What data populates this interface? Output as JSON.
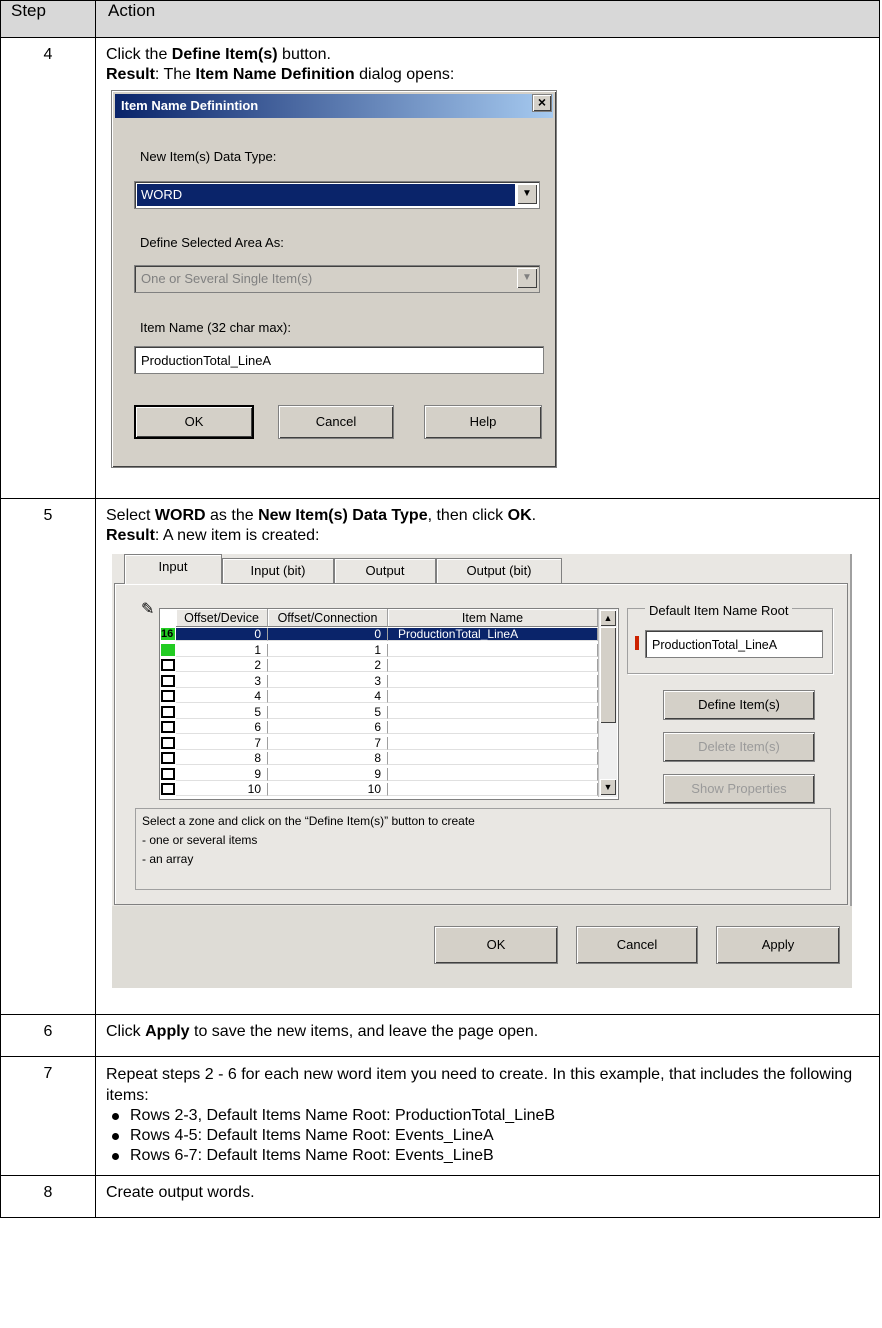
{
  "header": {
    "step": "Step",
    "action": "Action"
  },
  "steps": {
    "s4": {
      "num": "4",
      "line1": {
        "pre": "Click the ",
        "bold": "Define Item(s)",
        "post": " button."
      },
      "line2": {
        "b1": "Result",
        "t1": ": The ",
        "b2": "Item Name Definition",
        "t2": " dialog opens:"
      }
    },
    "s5": {
      "num": "5",
      "line1": {
        "t1": "Select ",
        "b1": "WORD",
        "t2": " as the ",
        "b2": "New Item(s) Data Type",
        "t3": ", then click ",
        "b3": "OK",
        "t4": "."
      },
      "line2": {
        "b1": "Result",
        "t1": ": A new item is created:"
      }
    },
    "s6": {
      "num": "6",
      "t1": "Click ",
      "b1": "Apply",
      "t2": " to save the new items, and leave the page open."
    },
    "s7": {
      "num": "7",
      "text": "Repeat steps 2 - 6 for each new word item you need to create. In this example, that includes the following items:",
      "items": [
        "Rows 2-3, Default Items Name Root: ProductionTotal_LineB",
        "Rows 4-5: Default Items Name Root: Events_LineA",
        "Rows 6-7: Default Items Name Root: Events_LineB"
      ]
    },
    "s8": {
      "num": "8",
      "text": "Create output words."
    }
  },
  "dialog": {
    "title": "Item Name Definintion",
    "close": "×",
    "data_type_label": "New Item(s) Data Type:",
    "data_type_value": "WORD",
    "area_label": "Define Selected Area As:",
    "area_value": "One or Several Single Item(s)",
    "name_label": "Item Name (32 char max):",
    "name_value": "ProductionTotal_LineA",
    "ok": "OK",
    "cancel": "Cancel",
    "help": "Help"
  },
  "panel": {
    "tabs": [
      "Input",
      "Input (bit)",
      "Output",
      "Output (bit)"
    ],
    "columns": [
      "Offset/Device",
      "Offset/Connection",
      "Item Name"
    ],
    "badge": "16",
    "rows": [
      {
        "dev": "0",
        "conn": "0",
        "name": "ProductionTotal_LineA"
      },
      {
        "dev": "1",
        "conn": "1",
        "name": ""
      },
      {
        "dev": "2",
        "conn": "2",
        "name": ""
      },
      {
        "dev": "3",
        "conn": "3",
        "name": ""
      },
      {
        "dev": "4",
        "conn": "4",
        "name": ""
      },
      {
        "dev": "5",
        "conn": "5",
        "name": ""
      },
      {
        "dev": "6",
        "conn": "6",
        "name": ""
      },
      {
        "dev": "7",
        "conn": "7",
        "name": ""
      },
      {
        "dev": "8",
        "conn": "8",
        "name": ""
      },
      {
        "dev": "9",
        "conn": "9",
        "name": ""
      },
      {
        "dev": "10",
        "conn": "10",
        "name": ""
      }
    ],
    "root_group_label": "Default Item Name Root",
    "root_value": "ProductionTotal_LineA",
    "define_button": "Define Item(s)",
    "delete_button": "Delete Item(s)",
    "properties_button": "Show Properties",
    "info_lines": [
      "Select a zone and click on the “Define Item(s)” button to create",
      "- one or several items",
      "- an array"
    ],
    "ok": "OK",
    "cancel": "Cancel",
    "apply": "Apply"
  },
  "colors": {
    "titlebar": "#0a246a",
    "selection": "#0a246a",
    "checkbox_on": "#22cc22"
  }
}
